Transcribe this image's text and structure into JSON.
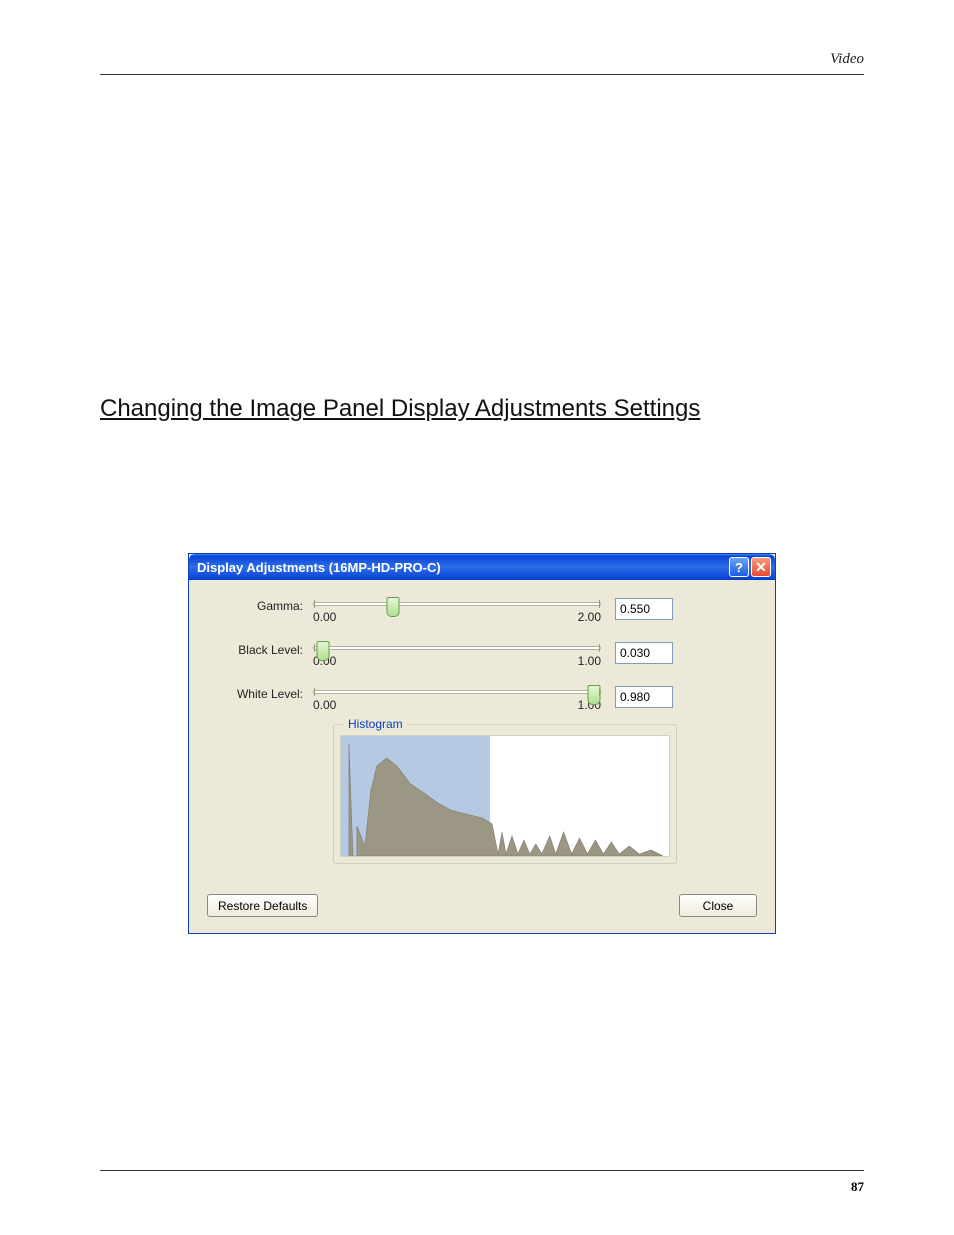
{
  "header": {
    "section": "Video"
  },
  "heading": "Changing the Image Panel Display Adjustments Settings",
  "dialog": {
    "title": "Display Adjustments (16MP-HD-PRO-C)",
    "sliders": {
      "gamma": {
        "label": "Gamma:",
        "min": "0.00",
        "max": "2.00",
        "value": "0.550",
        "pos_pct": 27.5
      },
      "black": {
        "label": "Black Level:",
        "min": "0.00",
        "max": "1.00",
        "value": "0.030",
        "pos_pct": 3.0
      },
      "white": {
        "label": "White Level:",
        "min": "0.00",
        "max": "1.00",
        "value": "0.980",
        "pos_pct": 98.0
      }
    },
    "histogram_label": "Histogram",
    "buttons": {
      "restore": "Restore Defaults",
      "close": "Close"
    }
  },
  "footer": {
    "page": "87"
  }
}
